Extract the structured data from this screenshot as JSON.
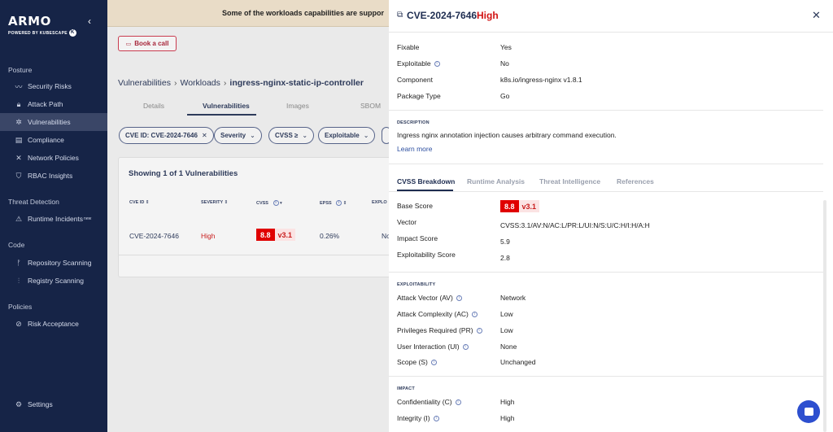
{
  "sidebar": {
    "logo": "ARMO",
    "logo_sub": "POWERED BY KUBESCAPE",
    "sections": {
      "posture": "Posture",
      "threat": "Threat Detection",
      "code": "Code",
      "policies": "Policies"
    },
    "items": [
      {
        "label": "Security Risks",
        "icon": "trend-icon"
      },
      {
        "label": "Attack Path",
        "icon": "lock-icon"
      },
      {
        "label": "Vulnerabilities",
        "icon": "bug-icon"
      },
      {
        "label": "Compliance",
        "icon": "clipboard-icon"
      },
      {
        "label": "Network Policies",
        "icon": "network-icon"
      },
      {
        "label": "RBAC Insights",
        "icon": "shield-user-icon"
      },
      {
        "label": "Runtime Incidents",
        "icon": "warning-icon",
        "badge": "new"
      },
      {
        "label": "Repository Scanning",
        "icon": "branch-icon"
      },
      {
        "label": "Registry Scanning",
        "icon": "registry-icon"
      },
      {
        "label": "Risk Acceptance",
        "icon": "eye-off-icon"
      },
      {
        "label": "Settings",
        "icon": "gear-icon"
      }
    ]
  },
  "main": {
    "banner": "Some of the workloads capabilities are suppor",
    "book_call": "Book a call",
    "breadcrumb": [
      "Vulnerabilities",
      "Workloads",
      "ingress-nginx-static-ip-controller"
    ],
    "tabs": [
      "Details",
      "Vulnerabilities",
      "Images",
      "SBOM"
    ],
    "filters": [
      "CVE ID: CVE-2024-7646",
      "Severity",
      "CVSS ≥",
      "Exploitable"
    ],
    "table": {
      "title": "Showing 1 of 1 Vulnerabilities",
      "headers": [
        "CVE ID",
        "SEVERITY",
        "CVSS",
        "EPSS",
        "EXPLO"
      ],
      "row": {
        "cve": "CVE-2024-7646",
        "severity": "High",
        "score": "8.8",
        "version": "v3.1",
        "epss": "0.26%",
        "exploitable": "No"
      }
    }
  },
  "drawer": {
    "title": "CVE-2024-7646",
    "severity": "High",
    "fields": [
      {
        "label": "Fixable",
        "value": "Yes"
      },
      {
        "label": "Exploitable",
        "value": "No"
      },
      {
        "label": "Component",
        "value": "k8s.io/ingress-nginx v1.8.1"
      },
      {
        "label": "Package Type",
        "value": "Go"
      }
    ],
    "description_title": "DESCRIPTION",
    "description": "Ingress nginx annotation injection causes arbitrary command execution.",
    "learn_more": "Learn more",
    "tabs": [
      "CVSS Breakdown",
      "Runtime Analysis",
      "Threat Intelligence",
      "References"
    ],
    "cvss": {
      "base_label": "Base Score",
      "base_score": "8.8",
      "base_version": "v3.1",
      "vector_label": "Vector",
      "vector": "CVSS:3.1/AV:N/AC:L/PR:L/UI:N/S:U/C:H/I:H/A:H",
      "impact_label": "Impact Score",
      "impact": "5.9",
      "exploitability_label": "Exploitability Score",
      "exploitability": "2.8"
    },
    "exploitability_title": "EXPLOITABILITY",
    "exploitability": [
      {
        "label": "Attack Vector (AV)",
        "value": "Network"
      },
      {
        "label": "Attack Complexity (AC)",
        "value": "Low"
      },
      {
        "label": "Privileges Required (PR)",
        "value": "Low"
      },
      {
        "label": "User Interaction (UI)",
        "value": "None"
      },
      {
        "label": "Scope (S)",
        "value": "Unchanged"
      }
    ],
    "impact_title": "IMPACT",
    "impact": [
      {
        "label": "Confidentiality (C)",
        "value": "High"
      },
      {
        "label": "Integrity (I)",
        "value": "High"
      }
    ]
  }
}
